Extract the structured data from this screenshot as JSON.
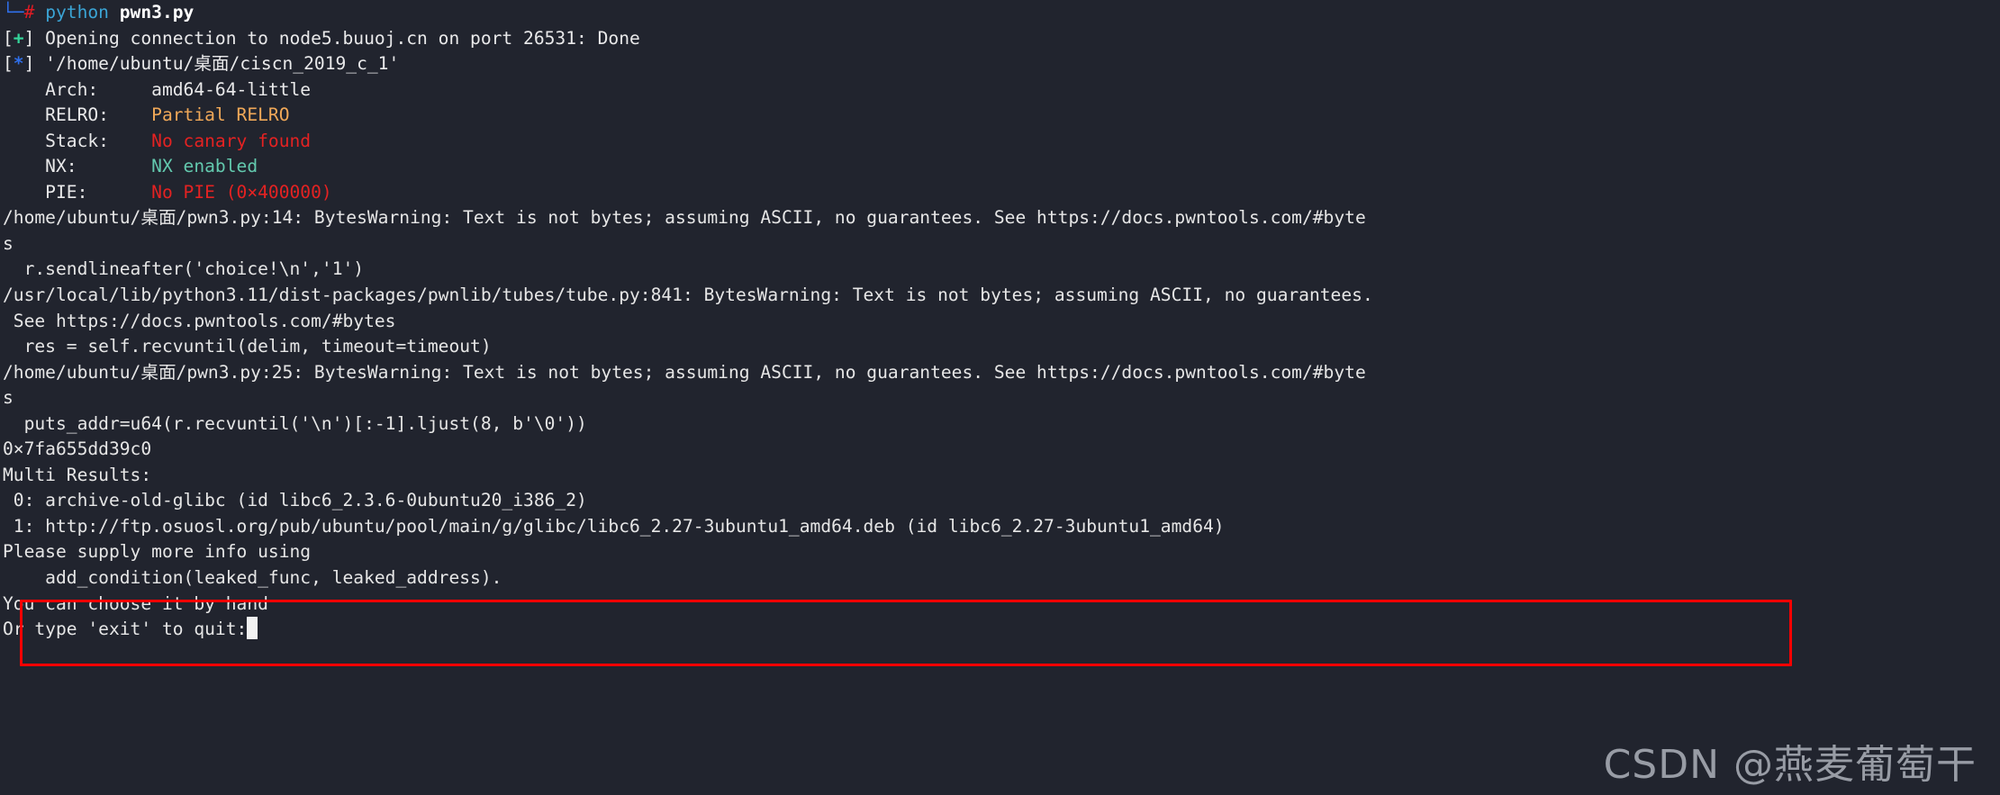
{
  "terminal": {
    "background_color": "#21242e",
    "foreground_color": "#e9e9ea",
    "prompt": {
      "branch_glyph": "└─",
      "hash": "#",
      "command": "python",
      "argument": "pwn3.py"
    },
    "status_markers": {
      "success_open": "[",
      "success_symbol": "+",
      "success_close": "]",
      "info_open": "[",
      "info_symbol": "*",
      "info_close": "]"
    },
    "lines": {
      "opening_connection": " Opening connection to node5.buuoj.cn on port 26531: Done",
      "binary_path": " '/home/ubuntu/桌面/ciscn_2019_c_1'",
      "checksec": [
        {
          "label": "    Arch:     ",
          "value": "amd64-64-little",
          "color": "#e9e9ea"
        },
        {
          "label": "    RELRO:    ",
          "value": "Partial RELRO",
          "color": "#f0a858"
        },
        {
          "label": "    Stack:    ",
          "value": "No canary found",
          "color": "#e42222"
        },
        {
          "label": "    NX:       ",
          "value": "NX enabled",
          "color": "#63c9ae"
        },
        {
          "label": "    PIE:      ",
          "value": "No PIE (0×400000)",
          "color": "#e42222"
        }
      ],
      "warning1_a": "/home/ubuntu/桌面/pwn3.py:14: BytesWarning: Text is not bytes; assuming ASCII, no guarantees. See https://docs.pwntools.com/#byte",
      "warning1_b": "s",
      "warning1_src": "  r.sendlineafter('choice!\\n','1')",
      "warning2_a": "/usr/local/lib/python3.11/dist-packages/pwnlib/tubes/tube.py:841: BytesWarning: Text is not bytes; assuming ASCII, no guarantees.",
      "warning2_b": " See https://docs.pwntools.com/#bytes",
      "warning2_src": "  res = self.recvuntil(delim, timeout=timeout)",
      "warning3_a": "/home/ubuntu/桌面/pwn3.py:25: BytesWarning: Text is not bytes; assuming ASCII, no guarantees. See https://docs.pwntools.com/#byte",
      "warning3_b": "s",
      "warning3_src": "  puts_addr=u64(r.recvuntil('\\n')[:-1].ljust(8, b'\\0'))",
      "leaked_address": "0×7fa655dd39c0",
      "multi_results_header": "Multi Results:",
      "result_0": " 0: archive-old-glibc (id libc6_2.3.6-0ubuntu20_i386_2)",
      "result_1": " 1: http://ftp.osuosl.org/pub/ubuntu/pool/main/g/glibc/libc6_2.27-3ubuntu1_amd64.deb (id libc6_2.27-3ubuntu1_amd64)",
      "please_supply": "Please supply more info using",
      "add_condition": "    add_condition(leaked_func, leaked_address).",
      "choose_by_hand": "You can choose it by hand",
      "or_type_exit": "Or type 'exit' to quit:"
    },
    "highlight_box": {
      "color": "#fb0000",
      "border_width": 3
    },
    "cursor": {
      "style": "block",
      "color": "#f2f2f2"
    }
  },
  "watermark": {
    "text": "CSDN @燕麦葡萄干",
    "color": "#a9adb6"
  }
}
